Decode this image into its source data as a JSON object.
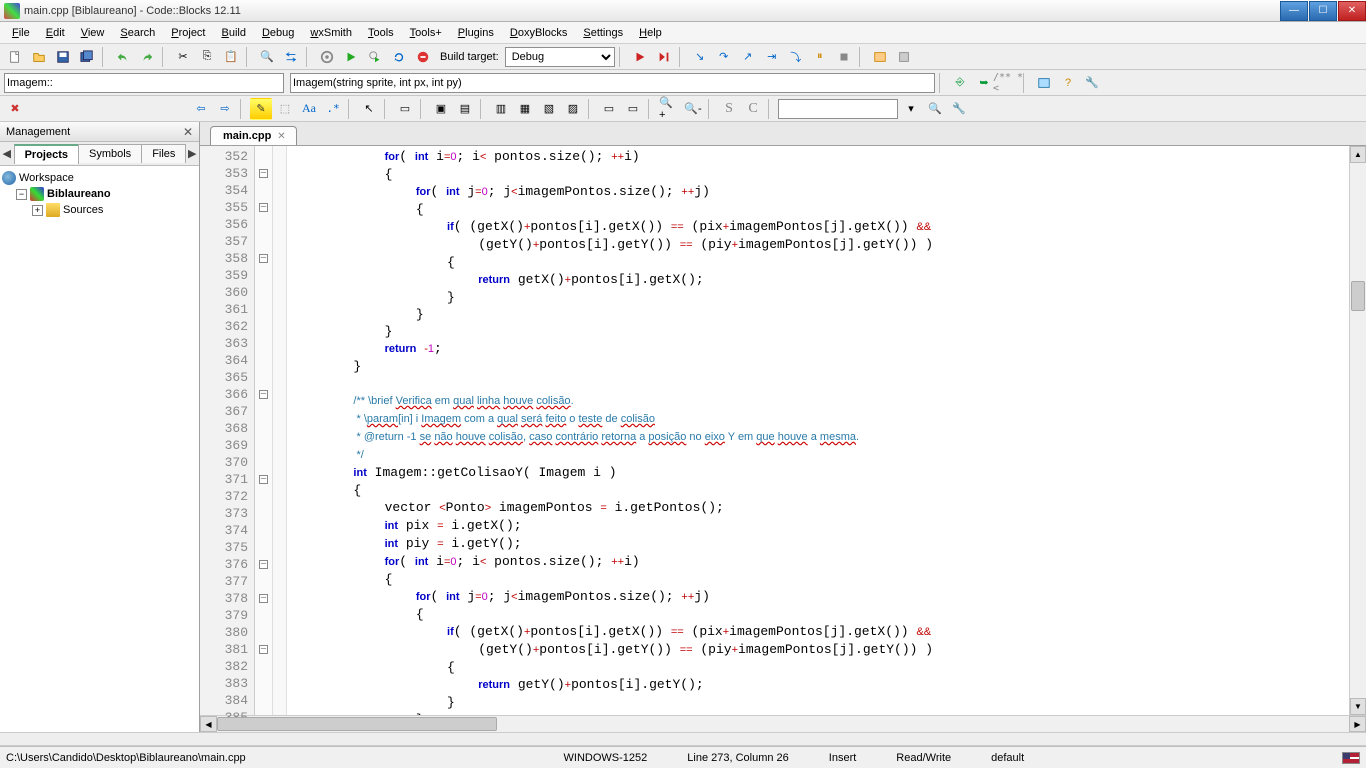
{
  "window": {
    "title": "main.cpp [Biblaureano] - Code::Blocks 12.11"
  },
  "menu": {
    "items": [
      "File",
      "Edit",
      "View",
      "Search",
      "Project",
      "Build",
      "Debug",
      "wxSmith",
      "Tools",
      "Tools+",
      "Plugins",
      "DoxyBlocks",
      "Settings",
      "Help"
    ]
  },
  "toolbar1": {
    "build_target_label": "Build target:",
    "build_target_value": "Debug"
  },
  "toolbar2": {
    "scope": "Imagem::",
    "signature": "Imagem(string sprite, int px, int py)"
  },
  "management": {
    "title": "Management",
    "tabs": [
      "Projects",
      "Symbols",
      "Files"
    ],
    "active_tab": 0,
    "workspace": "Workspace",
    "project": "Biblaureano",
    "folder": "Sources"
  },
  "file_tab": {
    "name": "main.cpp"
  },
  "code": {
    "first_line": 352,
    "lines": [
      {
        "n": 352,
        "fold": "",
        "html": "            <span class='kw'>for</span>( <span class='kw'>int</span> i<span class='op'>=</span><span class='num'>0</span>; i<span class='op'>&lt;</span> pontos.size(); <span class='op'>++</span>i)"
      },
      {
        "n": 353,
        "fold": "box",
        "html": "            {"
      },
      {
        "n": 354,
        "fold": "",
        "html": "                <span class='kw'>for</span>( <span class='kw'>int</span> j<span class='op'>=</span><span class='num'>0</span>; j<span class='op'>&lt;</span>imagemPontos.size(); <span class='op'>++</span>j)"
      },
      {
        "n": 355,
        "fold": "box",
        "html": "                {"
      },
      {
        "n": 356,
        "fold": "",
        "html": "                    <span class='kw'>if</span>( (getX()<span class='op'>+</span>pontos[i].getX()) <span class='op'>==</span> (pix<span class='op'>+</span>imagemPontos[j].getX()) <span class='op'>&amp;&amp;</span>"
      },
      {
        "n": 357,
        "fold": "",
        "html": "                        (getY()<span class='op'>+</span>pontos[i].getY()) <span class='op'>==</span> (piy<span class='op'>+</span>imagemPontos[j].getY()) )"
      },
      {
        "n": 358,
        "fold": "box",
        "html": "                    {"
      },
      {
        "n": 359,
        "fold": "",
        "html": "                        <span class='kw'>return</span> getX()<span class='op'>+</span>pontos[i].getX();"
      },
      {
        "n": 360,
        "fold": "",
        "html": "                    }"
      },
      {
        "n": 361,
        "fold": "",
        "html": "                }"
      },
      {
        "n": 362,
        "fold": "",
        "html": "            }"
      },
      {
        "n": 363,
        "fold": "",
        "html": "            <span class='kw'>return</span> <span class='op'>-</span><span class='num'>1</span>;"
      },
      {
        "n": 364,
        "fold": "",
        "html": "        }"
      },
      {
        "n": 365,
        "fold": "",
        "html": ""
      },
      {
        "n": 366,
        "fold": "box",
        "html": "        <span class='doccmt'>/** \\brief <span class='spell'>Verifica</span> em <span class='spell'>qual</span> <span class='spell'>linha</span> <span class='spell'>houve</span> <span class='spell'>colisão</span>.</span>"
      },
      {
        "n": 367,
        "fold": "",
        "html": "        <span class='doccmt'> * \\<span class='spell'>param</span>[in] i <span class='spell'>Imagem</span> com a <span class='spell'>qual</span> <span class='spell'>será</span> <span class='spell'>feito</span> o <span class='spell'>teste</span> de <span class='spell'>colisão</span></span>"
      },
      {
        "n": 368,
        "fold": "",
        "html": "        <span class='doccmt'> * @return -1 <span class='spell'>se</span> <span class='spell'>não</span> <span class='spell'>houve</span> <span class='spell'>colisão</span>, <span class='spell'>caso</span> <span class='spell'>contrário</span> <span class='spell'>retorna</span> a <span class='spell'>posição</span> no <span class='spell'>eixo</span> Y em <span class='spell'>que</span> <span class='spell'>houve</span> a <span class='spell'>mesma</span>.</span>"
      },
      {
        "n": 369,
        "fold": "",
        "html": "        <span class='doccmt'> */</span>"
      },
      {
        "n": 370,
        "fold": "",
        "html": "        <span class='kw'>int</span> Imagem::getColisaoY( Imagem i )"
      },
      {
        "n": 371,
        "fold": "box",
        "html": "        {"
      },
      {
        "n": 372,
        "fold": "",
        "html": "            vector <span class='op'>&lt;</span>Ponto<span class='op'>&gt;</span> imagemPontos <span class='op'>=</span> i.getPontos();"
      },
      {
        "n": 373,
        "fold": "",
        "html": "            <span class='kw'>int</span> pix <span class='op'>=</span> i.getX();"
      },
      {
        "n": 374,
        "fold": "",
        "html": "            <span class='kw'>int</span> piy <span class='op'>=</span> i.getY();"
      },
      {
        "n": 375,
        "fold": "",
        "html": "            <span class='kw'>for</span>( <span class='kw'>int</span> i<span class='op'>=</span><span class='num'>0</span>; i<span class='op'>&lt;</span> pontos.size(); <span class='op'>++</span>i)"
      },
      {
        "n": 376,
        "fold": "box",
        "html": "            {"
      },
      {
        "n": 377,
        "fold": "",
        "html": "                <span class='kw'>for</span>( <span class='kw'>int</span> j<span class='op'>=</span><span class='num'>0</span>; j<span class='op'>&lt;</span>imagemPontos.size(); <span class='op'>++</span>j)"
      },
      {
        "n": 378,
        "fold": "box",
        "html": "                {"
      },
      {
        "n": 379,
        "fold": "",
        "html": "                    <span class='kw'>if</span>( (getX()<span class='op'>+</span>pontos[i].getX()) <span class='op'>==</span> (pix<span class='op'>+</span>imagemPontos[j].getX()) <span class='op'>&amp;&amp;</span>"
      },
      {
        "n": 380,
        "fold": "",
        "html": "                        (getY()<span class='op'>+</span>pontos[i].getY()) <span class='op'>==</span> (piy<span class='op'>+</span>imagemPontos[j].getY()) )"
      },
      {
        "n": 381,
        "fold": "box",
        "html": "                    {"
      },
      {
        "n": 382,
        "fold": "",
        "html": "                        <span class='kw'>return</span> getY()<span class='op'>+</span>pontos[i].getY();"
      },
      {
        "n": 383,
        "fold": "",
        "html": "                    }"
      },
      {
        "n": 384,
        "fold": "",
        "html": "                }"
      },
      {
        "n": 385,
        "fold": "",
        "html": "            }"
      }
    ]
  },
  "status": {
    "path": "C:\\Users\\Candido\\Desktop\\Biblaureano\\main.cpp",
    "encoding": "WINDOWS-1252",
    "position": "Line 273, Column 26",
    "insert": "Insert",
    "rw": "Read/Write",
    "eol": "default"
  }
}
